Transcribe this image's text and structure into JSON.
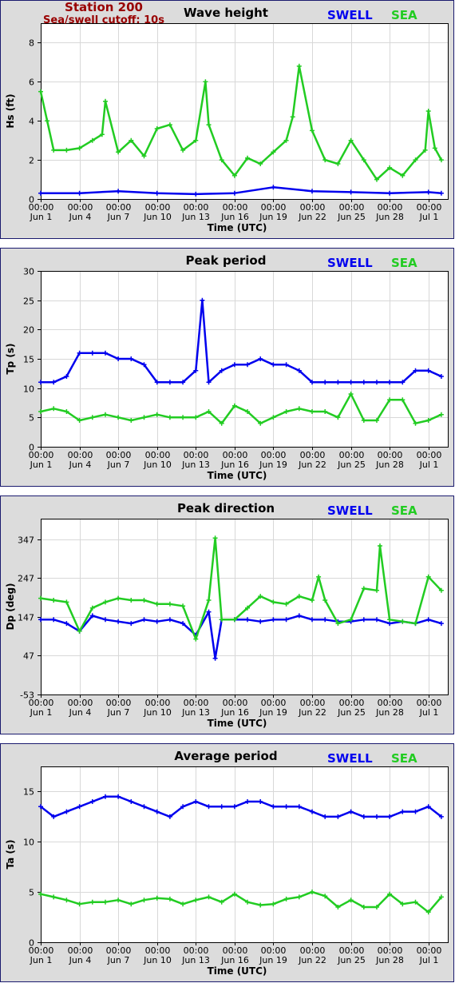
{
  "header": {
    "station": "Station 200",
    "cutoff": "Sea/swell cutoff: 10s"
  },
  "legend": {
    "swell": "SWELL",
    "sea": "SEA"
  },
  "colors": {
    "swell": "#0000ee",
    "sea": "#22cc22",
    "header": "#990000"
  },
  "x_ticks": [
    [
      "00:00",
      "Jun 1"
    ],
    [
      "00:00",
      "Jun 4"
    ],
    [
      "00:00",
      "Jun 7"
    ],
    [
      "00:00",
      "Jun 10"
    ],
    [
      "00:00",
      "Jun 13"
    ],
    [
      "00:00",
      "Jun 16"
    ],
    [
      "00:00",
      "Jun 19"
    ],
    [
      "00:00",
      "Jun 22"
    ],
    [
      "00:00",
      "Jun 25"
    ],
    [
      "00:00",
      "Jun 28"
    ],
    [
      "00:00",
      "Jul 1"
    ]
  ],
  "chart_data": [
    {
      "type": "line",
      "title": "Wave height",
      "xlabel": "Time (UTC)",
      "ylabel": "Hs (ft)",
      "ylim": [
        0,
        9
      ],
      "yticks": [
        0,
        2,
        4,
        6,
        8
      ],
      "xlim": [
        "Jun 1 00:00",
        "Jul 2 12:00"
      ],
      "grid": true,
      "legend_placement": "top-right",
      "series": [
        {
          "name": "SWELL",
          "x": [
            "Jun 1",
            "Jun 4",
            "Jun 7",
            "Jun 10",
            "Jun 13",
            "Jun 16",
            "Jun 19",
            "Jun 22",
            "Jun 25",
            "Jun 28",
            "Jul 1",
            "Jul 2"
          ],
          "values": [
            0.3,
            0.3,
            0.4,
            0.3,
            0.25,
            0.3,
            0.6,
            0.4,
            0.35,
            0.3,
            0.35,
            0.3
          ]
        },
        {
          "name": "SEA",
          "x": [
            "Jun 1",
            "Jun 1 12:00",
            "Jun 2",
            "Jun 3",
            "Jun 4",
            "Jun 5",
            "Jun 5 18:00",
            "Jun 6",
            "Jun 7",
            "Jun 8",
            "Jun 9",
            "Jun 10",
            "Jun 11",
            "Jun 12",
            "Jun 13",
            "Jun 13 18:00",
            "Jun 14",
            "Jun 15",
            "Jun 16",
            "Jun 17",
            "Jun 18",
            "Jun 19",
            "Jun 20",
            "Jun 20 12:00",
            "Jun 21",
            "Jun 22",
            "Jun 23",
            "Jun 24",
            "Jun 25",
            "Jun 26",
            "Jun 27",
            "Jun 28",
            "Jun 29",
            "Jun 30",
            "Jun 30 18:00",
            "Jul 1",
            "Jul 1 12:00",
            "Jul 2"
          ],
          "values": [
            5.5,
            4.0,
            2.5,
            2.5,
            2.6,
            3.0,
            3.3,
            5.0,
            2.4,
            3.0,
            2.2,
            3.6,
            3.8,
            2.5,
            3.0,
            6.0,
            3.8,
            2.0,
            1.2,
            2.1,
            1.8,
            2.4,
            3.0,
            4.2,
            6.8,
            3.5,
            2.0,
            1.8,
            3.0,
            2.0,
            1.0,
            1.6,
            1.2,
            2.0,
            2.5,
            4.5,
            2.6,
            2.0
          ]
        }
      ]
    },
    {
      "type": "line",
      "title": "Peak period",
      "xlabel": "Time (UTC)",
      "ylabel": "Tp (s)",
      "ylim": [
        0,
        30
      ],
      "yticks": [
        0,
        5,
        10,
        15,
        20,
        25,
        30
      ],
      "xlim": [
        "Jun 1 00:00",
        "Jul 2 12:00"
      ],
      "grid": true,
      "legend_placement": "top-right",
      "series": [
        {
          "name": "SWELL",
          "x": [
            "Jun 1",
            "Jun 2",
            "Jun 3",
            "Jun 4",
            "Jun 5",
            "Jun 6",
            "Jun 7",
            "Jun 8",
            "Jun 9",
            "Jun 10",
            "Jun 11",
            "Jun 12",
            "Jun 13",
            "Jun 13 12:00",
            "Jun 14",
            "Jun 15",
            "Jun 16",
            "Jun 17",
            "Jun 18",
            "Jun 19",
            "Jun 20",
            "Jun 21",
            "Jun 22",
            "Jun 23",
            "Jun 24",
            "Jun 25",
            "Jun 26",
            "Jun 27",
            "Jun 28",
            "Jun 29",
            "Jun 30",
            "Jul 1",
            "Jul 2"
          ],
          "values": [
            11,
            11,
            12,
            16,
            16,
            16,
            15,
            15,
            14,
            11,
            11,
            11,
            13,
            25,
            11,
            13,
            14,
            14,
            15,
            14,
            14,
            13,
            11,
            11,
            11,
            11,
            11,
            11,
            11,
            11,
            13,
            13,
            12
          ]
        },
        {
          "name": "SEA",
          "x": [
            "Jun 1",
            "Jun 2",
            "Jun 3",
            "Jun 4",
            "Jun 5",
            "Jun 6",
            "Jun 7",
            "Jun 8",
            "Jun 9",
            "Jun 10",
            "Jun 11",
            "Jun 12",
            "Jun 13",
            "Jun 14",
            "Jun 15",
            "Jun 16",
            "Jun 17",
            "Jun 18",
            "Jun 19",
            "Jun 20",
            "Jun 21",
            "Jun 22",
            "Jun 23",
            "Jun 24",
            "Jun 25",
            "Jun 26",
            "Jun 27",
            "Jun 28",
            "Jun 29",
            "Jun 30",
            "Jul 1",
            "Jul 2"
          ],
          "values": [
            6,
            6.5,
            6,
            4.5,
            5,
            5.5,
            5,
            4.5,
            5,
            5.5,
            5,
            5,
            5,
            6,
            4,
            7,
            6,
            4,
            5,
            6,
            6.5,
            6,
            6,
            5,
            9,
            4.5,
            4.5,
            8,
            8,
            4,
            4.5,
            5.5
          ]
        }
      ]
    },
    {
      "type": "line",
      "title": "Peak direction",
      "xlabel": "Time (UTC)",
      "ylabel": "Dp (deg)",
      "ylim": [
        -53,
        400
      ],
      "yticks": [
        -53,
        47,
        147,
        247,
        347
      ],
      "xlim": [
        "Jun 1 00:00",
        "Jul 2 12:00"
      ],
      "grid": true,
      "legend_placement": "top-right",
      "series": [
        {
          "name": "SWELL",
          "x": [
            "Jun 1",
            "Jun 2",
            "Jun 3",
            "Jun 4",
            "Jun 5",
            "Jun 6",
            "Jun 7",
            "Jun 8",
            "Jun 9",
            "Jun 10",
            "Jun 11",
            "Jun 12",
            "Jun 13",
            "Jun 14",
            "Jun 14 12:00",
            "Jun 15",
            "Jun 16",
            "Jun 17",
            "Jun 18",
            "Jun 19",
            "Jun 20",
            "Jun 21",
            "Jun 22",
            "Jun 23",
            "Jun 24",
            "Jun 25",
            "Jun 26",
            "Jun 27",
            "Jun 28",
            "Jun 29",
            "Jun 30",
            "Jul 1",
            "Jul 2"
          ],
          "values": [
            140,
            140,
            130,
            110,
            150,
            140,
            135,
            130,
            140,
            135,
            140,
            130,
            100,
            160,
            40,
            140,
            140,
            140,
            135,
            140,
            140,
            150,
            140,
            140,
            135,
            135,
            140,
            140,
            130,
            135,
            130,
            140,
            130
          ]
        },
        {
          "name": "SEA",
          "x": [
            "Jun 1",
            "Jun 2",
            "Jun 3",
            "Jun 4",
            "Jun 5",
            "Jun 6",
            "Jun 7",
            "Jun 8",
            "Jun 9",
            "Jun 10",
            "Jun 11",
            "Jun 12",
            "Jun 13",
            "Jun 14",
            "Jun 14 12:00",
            "Jun 15",
            "Jun 16",
            "Jun 17",
            "Jun 18",
            "Jun 19",
            "Jun 20",
            "Jun 21",
            "Jun 22",
            "Jun 22 12:00",
            "Jun 23",
            "Jun 24",
            "Jun 25",
            "Jun 26",
            "Jun 27",
            "Jun 27 06:00",
            "Jun 28",
            "Jun 29",
            "Jun 30",
            "Jul 1",
            "Jul 2"
          ],
          "values": [
            195,
            190,
            185,
            110,
            170,
            185,
            195,
            190,
            190,
            180,
            180,
            175,
            90,
            190,
            350,
            140,
            140,
            170,
            200,
            185,
            180,
            200,
            190,
            250,
            190,
            130,
            140,
            220,
            215,
            330,
            140,
            135,
            130,
            250,
            215
          ]
        }
      ]
    },
    {
      "type": "line",
      "title": "Average period",
      "xlabel": "Time (UTC)",
      "ylabel": "Ta (s)",
      "ylim": [
        0,
        17.5
      ],
      "yticks": [
        0,
        5,
        10,
        15
      ],
      "xlim": [
        "Jun 1 00:00",
        "Jul 2 12:00"
      ],
      "grid": true,
      "legend_placement": "top-right",
      "series": [
        {
          "name": "SWELL",
          "x": [
            "Jun 1",
            "Jun 2",
            "Jun 3",
            "Jun 4",
            "Jun 5",
            "Jun 6",
            "Jun 7",
            "Jun 8",
            "Jun 9",
            "Jun 10",
            "Jun 11",
            "Jun 12",
            "Jun 13",
            "Jun 14",
            "Jun 15",
            "Jun 16",
            "Jun 17",
            "Jun 18",
            "Jun 19",
            "Jun 20",
            "Jun 21",
            "Jun 22",
            "Jun 23",
            "Jun 24",
            "Jun 25",
            "Jun 26",
            "Jun 27",
            "Jun 28",
            "Jun 29",
            "Jun 30",
            "Jul 1",
            "Jul 2"
          ],
          "values": [
            13.5,
            12.5,
            13,
            13.5,
            14,
            14.5,
            14.5,
            14,
            13.5,
            13,
            12.5,
            13.5,
            14,
            13.5,
            13.5,
            13.5,
            14,
            14,
            13.5,
            13.5,
            13.5,
            13,
            12.5,
            12.5,
            13,
            12.5,
            12.5,
            12.5,
            13,
            13,
            13.5,
            12.5
          ]
        },
        {
          "name": "SEA",
          "x": [
            "Jun 1",
            "Jun 2",
            "Jun 3",
            "Jun 4",
            "Jun 5",
            "Jun 6",
            "Jun 7",
            "Jun 8",
            "Jun 9",
            "Jun 10",
            "Jun 11",
            "Jun 12",
            "Jun 13",
            "Jun 14",
            "Jun 15",
            "Jun 16",
            "Jun 17",
            "Jun 18",
            "Jun 19",
            "Jun 20",
            "Jun 21",
            "Jun 22",
            "Jun 23",
            "Jun 24",
            "Jun 25",
            "Jun 26",
            "Jun 27",
            "Jun 28",
            "Jun 29",
            "Jun 30",
            "Jul 1",
            "Jul 2"
          ],
          "values": [
            4.8,
            4.5,
            4.2,
            3.8,
            4,
            4,
            4.2,
            3.8,
            4.2,
            4.4,
            4.3,
            3.8,
            4.2,
            4.5,
            4,
            4.8,
            4,
            3.7,
            3.8,
            4.3,
            4.5,
            5,
            4.6,
            3.5,
            4.2,
            3.5,
            3.5,
            4.8,
            3.8,
            4,
            3,
            4.5
          ]
        }
      ]
    }
  ]
}
